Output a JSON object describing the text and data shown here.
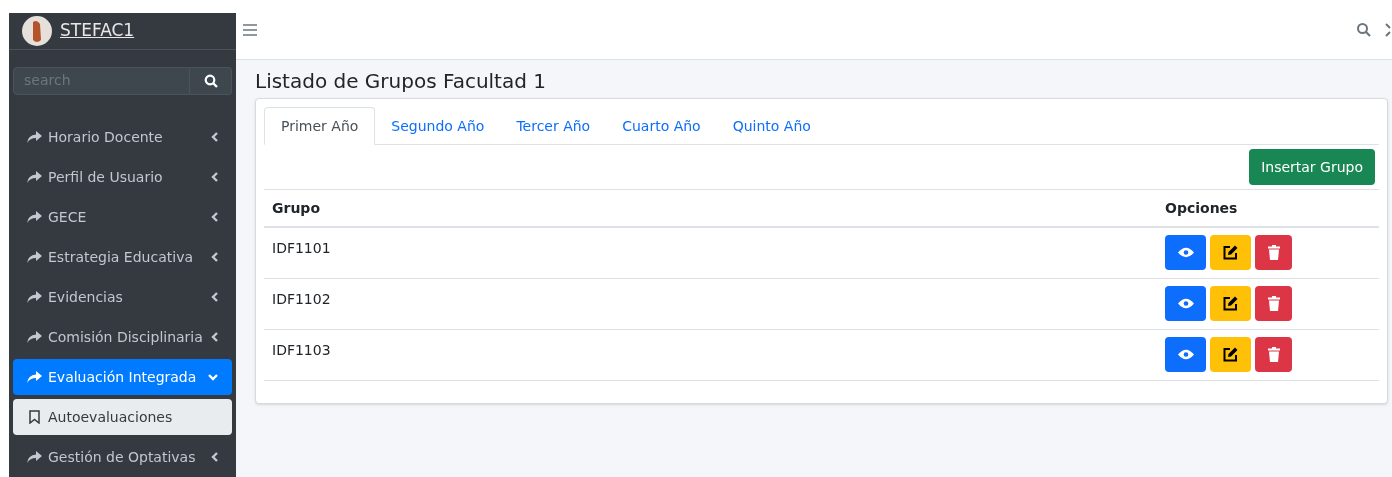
{
  "brand": {
    "name": "STEFAC1"
  },
  "sidebar": {
    "search": {
      "placeholder": "search"
    },
    "items": [
      {
        "label": "Horario Docente",
        "expanded": false,
        "selected": false
      },
      {
        "label": "Perfil de Usuario",
        "expanded": false,
        "selected": false
      },
      {
        "label": "GECE",
        "expanded": false,
        "selected": false
      },
      {
        "label": "Estrategia Educativa",
        "expanded": false,
        "selected": false
      },
      {
        "label": "Evidencias",
        "expanded": false,
        "selected": false
      },
      {
        "label": "Comisión Disciplinaria",
        "expanded": false,
        "selected": false
      },
      {
        "label": "Evaluación Integrada",
        "expanded": true,
        "selected": true,
        "children": [
          {
            "label": "Autoevaluaciones",
            "selected": true
          }
        ]
      },
      {
        "label": "Gestión de Optativas",
        "expanded": false,
        "selected": false
      }
    ]
  },
  "page_title": "Listado de Grupos Facultad 1",
  "tabs": [
    {
      "label": "Primer Año",
      "selected": true
    },
    {
      "label": "Segundo Año",
      "selected": false
    },
    {
      "label": "Tercer Año",
      "selected": false
    },
    {
      "label": "Cuarto Año",
      "selected": false
    },
    {
      "label": "Quinto Año",
      "selected": false
    }
  ],
  "insert_button": "Insertar Grupo",
  "table": {
    "columns": [
      "Grupo",
      "Opciones"
    ],
    "rows": [
      {
        "grupo": "IDF1101"
      },
      {
        "grupo": "IDF1102"
      },
      {
        "grupo": "IDF1103"
      }
    ]
  }
}
